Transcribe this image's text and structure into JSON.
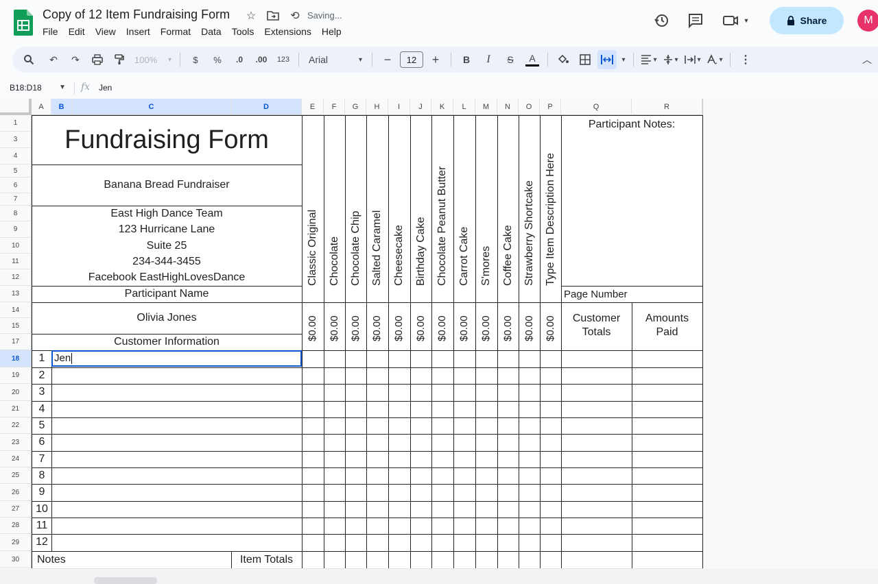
{
  "app": {
    "title": "Copy of 12 Item Fundraising Form",
    "saving_status": "Saving...",
    "menu": [
      "File",
      "Edit",
      "View",
      "Insert",
      "Format",
      "Data",
      "Tools",
      "Extensions",
      "Help"
    ],
    "share_label": "Share",
    "avatar_initial": "M"
  },
  "toolbar": {
    "zoom": "100%",
    "currency": "$",
    "percent": "%",
    "dec_decrease": ".0",
    "dec_increase": ".00",
    "number_format": "123",
    "font": "Arial",
    "font_size": "12",
    "bold": "B",
    "italic": "I",
    "strikethrough": "S",
    "text_color": "A"
  },
  "formula_bar": {
    "name_box": "B18:D18",
    "content": "Jen"
  },
  "columns": [
    "A",
    "B",
    "C",
    "D",
    "E",
    "F",
    "G",
    "H",
    "I",
    "J",
    "K",
    "L",
    "M",
    "N",
    "O",
    "P",
    "Q",
    "R"
  ],
  "rows": [
    "1",
    "3",
    "4",
    "5",
    "6",
    "7",
    "8",
    "9",
    "10",
    "11",
    "12",
    "13",
    "14",
    "15",
    "17",
    "18",
    "19",
    "20",
    "21",
    "22",
    "23",
    "24",
    "25",
    "26",
    "27",
    "28",
    "29",
    "30"
  ],
  "sheet": {
    "form_title": "Fundraising Form",
    "fundraiser_name": "Banana Bread Fundraiser",
    "org_lines": [
      "East High Dance Team",
      "123 Hurricane Lane",
      "Suite 25",
      "234-344-3455",
      "Facebook EastHighLovesDance"
    ],
    "participant_name_label": "Participant Name",
    "participant_name": "Olivia Jones",
    "customer_info_label": "Customer Information",
    "participant_notes_label": "Participant Notes:",
    "page_number_label": "Page Number",
    "customer_totals_label": [
      "Customer",
      "Totals"
    ],
    "amounts_paid_label": [
      "Amounts",
      "Paid"
    ],
    "items": [
      "Classic Original",
      "Chocolate",
      "Chocolate Chip",
      "Salted Caramel",
      "Cheesecake",
      "Birthday Cake",
      "Chocolate Peanut Butter",
      "Carrot Cake",
      "S'mores",
      "Coffee Cake",
      "Strawberry Shortcake",
      "Type Item Description Here"
    ],
    "item_totals": [
      "$0.00",
      "$0.00",
      "$0.00",
      "$0.00",
      "$0.00",
      "$0.00",
      "$0.00",
      "$0.00",
      "$0.00",
      "$0.00",
      "$0.00",
      "$0.00"
    ],
    "customer_numbers": [
      "1",
      "2",
      "3",
      "4",
      "5",
      "6",
      "7",
      "8",
      "9",
      "10",
      "11",
      "12"
    ],
    "first_customer_entry": "Jen",
    "notes_label": "Notes",
    "item_totals_label": "Item Totals"
  }
}
